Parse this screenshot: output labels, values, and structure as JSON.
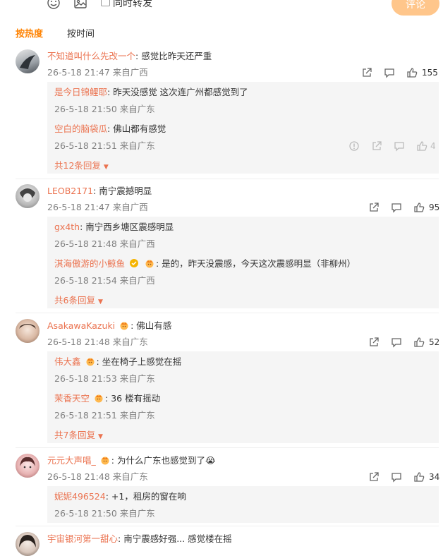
{
  "toolbar": {
    "emoji_icon": "smile-icon",
    "image_icon": "image-icon",
    "repost_label": "同时转发",
    "submit_label": "评论"
  },
  "sort": {
    "hot": "按热度",
    "time": "按时间"
  },
  "colors": {
    "username": "#eb7350",
    "accent": "#ff8200",
    "meta": "#808080"
  },
  "comments": [
    {
      "user": "不知道叫什么先改一个",
      "text": "感觉比昨天还严重",
      "time": "26-5-18 21:47 来自广西",
      "likes": "155",
      "replies": [
        {
          "user": "是今日锦鲤耶",
          "text": "昨天没感觉 这次连广州都感觉到了",
          "time": "26-5-18 21:50 来自广东"
        },
        {
          "user": "空白的脑袋瓜",
          "text": "佛山都有感觉",
          "time": "26-5-18 21:51 来自广东",
          "likes": "4"
        }
      ],
      "more": "共12条回复"
    },
    {
      "user": "LEOB2171",
      "text": "南宁震撼明显",
      "time": "26-5-18 21:47 来自广西",
      "likes": "95",
      "replies": [
        {
          "user": "gx4th",
          "text": "南宁西乡塘区震感明显",
          "time": "26-5-18 21:48 来自广西"
        },
        {
          "user": "淇海傲游的小鲸鱼",
          "text": "是的，昨天没震感，今天这次震感明显（非柳州）",
          "time": "26-5-18 21:54 来自广西"
        }
      ],
      "more": "共6条回复"
    },
    {
      "user": "AsakawaKazuki",
      "text": "佛山有感",
      "time": "26-5-18 21:48 来自广东",
      "likes": "52",
      "replies": [
        {
          "user": "伟大鑫",
          "text": "坐在椅子上感觉在摇",
          "time": "26-5-18 21:53 来自广东"
        },
        {
          "user": "茉香天空",
          "text": "36 楼有摇动",
          "time": "26-5-18 21:51 来自广东"
        }
      ],
      "more": "共7条回复"
    },
    {
      "user": "元元大声唱_",
      "text": "为什么广东也感觉到了😭",
      "time": "26-5-18 21:48 来自广东",
      "likes": "34",
      "replies": [
        {
          "user": "妮妮496524",
          "text": "+1，租房的窗在响",
          "time": "26-5-18 21:50 来自广东"
        }
      ]
    },
    {
      "user": "宇宙银河第一甜心",
      "text": "南宁震感好强... 感觉楼在摇"
    }
  ]
}
